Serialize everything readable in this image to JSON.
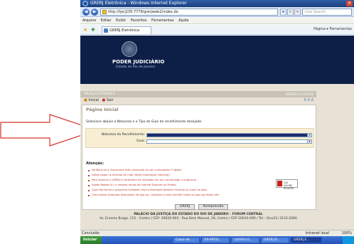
{
  "browser": {
    "window_title": "GRERJ Eletrônica - Windows Internet Explorer",
    "address": "http://tjsrj235:7779/grerjweb2/index.do",
    "search_placeholder": "Live Search",
    "menu": [
      "Arquivo",
      "Editar",
      "Exibir",
      "Favoritos",
      "Ferramentas",
      "Ajuda"
    ],
    "tab_label": "GRERJ Eletrônica",
    "tools_right": "Página ▾   Ferramentas",
    "status_left": "Concluído",
    "status_zone": "Intranet local",
    "status_zoom": "100%"
  },
  "banner": {
    "title": "PODER JUDICIÁRIO",
    "subtitle": "Estado do Rio de Janeiro"
  },
  "app": {
    "header": "GRERJ ELETRÔNICA",
    "version": "VERSÃO 4.1.0.0034",
    "nav_home": "Inicial",
    "nav_exit": "Sair",
    "font_controls": "A A A",
    "page_title": "Página Inicial",
    "instruction": "Selecione abaixo a Natureza e o Tipo de Guia do recolhimento desejado:",
    "nature_label": "Natureza do Recolhimento:",
    "guide_label": "Guia:",
    "attention": "Atenção:",
    "bullets": [
      "Verifique se a impressora está conectada ao seu computador e ligada.",
      "Utilize papel no formato A4 (não utilize impressora matricial).",
      "Para imprimir a GRERJ é necessário ter instalado em seu computador o programa",
      "Adobe Reader 8.1 e versões atuais do Internet Explorer ou Firefox.",
      "Caso não tenha o programa instalado, faça o download gratuito clicando no ícone ao lado.",
      "Caso esteja utilizando bloqueador de pop-up, configure-o para permitir todos os pop-ups deste site."
    ],
    "adobe_label": "Get ADOBE READER",
    "btn_grerj": "GRERJ",
    "btn_reimpressao": "Reimpressão",
    "footer_line1": "PALÁCIO DA JUSTIÇA DO ESTADO DO RIO DE JANEIRO - FORUM CENTRAL",
    "footer_line2": "Av. Erasmo Braga, 115 - Centro / CEP: 20020-903 - Rua Dom Manuel, 29, Centro / CEP 20010-090 / Tel.: (0xx21) 3133-2000"
  },
  "taskbar": {
    "start": "Iniciar",
    "tasks": [
      "Caixa de ...",
      "XX-APOLI...",
      "cartilha G...",
      "GRERJ El...",
      "GRERJ E..."
    ]
  },
  "colors": {
    "banner_bg": "#0d1f47",
    "page_bg": "#e7e2d5",
    "arrow_stroke": "#d2352a",
    "bullet_text": "#c0392b"
  }
}
